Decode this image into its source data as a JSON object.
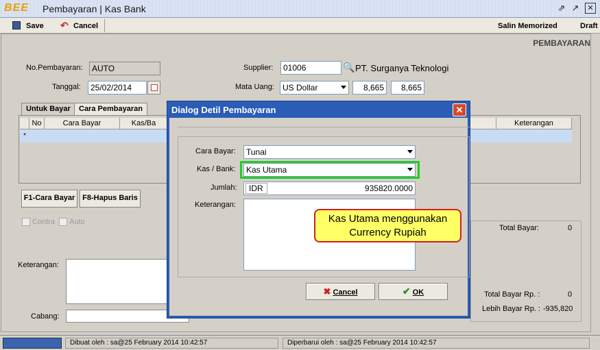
{
  "window": {
    "logo": "BEE",
    "title": "Pembayaran | Kas Bank"
  },
  "toolbar": {
    "save": "Save",
    "cancel": "Cancel",
    "salin": "Salin Memorized",
    "draft": "Draft"
  },
  "section_title": "PEMBAYARAN",
  "form": {
    "no_label": "No.Pembayaran:",
    "no_value": "AUTO",
    "tanggal_label": "Tanggal:",
    "tanggal_value": "25/02/2014",
    "supplier_label": "Supplier:",
    "supplier_code": "01006",
    "supplier_name": "PT. Surganya Teknologi",
    "mata_uang_label": "Mata Uang:",
    "mata_uang_value": "US Dollar",
    "rate1": "8,665",
    "rate2": "8,665"
  },
  "tabs": [
    "Untuk Bayar",
    "Cara Pembayaran"
  ],
  "grid": {
    "columns": [
      "No",
      "Cara Bayar",
      "Kas/Ba",
      "Keterangan"
    ],
    "new_row_marker": "*"
  },
  "buttons": {
    "f1": "F1-Cara Bayar",
    "f8": "F8-Hapus Baris"
  },
  "options": {
    "contra": "Contra",
    "auto": "Auto"
  },
  "footer_form": {
    "keterangan_label": "Keterangan:",
    "cabang_label": "Cabang:"
  },
  "totals": {
    "total_bayar_label": "Total Bayar:",
    "total_bayar_value": "0",
    "total_bayar_rp_label": "Total Bayar Rp. :",
    "total_bayar_rp_value": "0",
    "lebih_bayar_label": "Lebih Bayar Rp. :",
    "lebih_bayar_value": "-935,820"
  },
  "status": {
    "dibuat": "Dibuat oleh : sa@25 February 2014  10:42:57",
    "diperbarui": "Diperbarui oleh : sa@25 February 2014  10:42:57"
  },
  "dialog": {
    "title": "Dialog Detil Pembayaran",
    "cara_bayar_label": "Cara Bayar:",
    "cara_bayar_value": "Tunai",
    "kas_bank_label": "Kas / Bank:",
    "kas_bank_value": "Kas Utama",
    "jumlah_label": "Jumlah:",
    "jumlah_currency": "IDR",
    "jumlah_value": "935820.0000",
    "keterangan_label": "Keterangan:",
    "cancel": "Cancel",
    "ok": "OK"
  },
  "callout": {
    "line1": "Kas Utama menggunakan",
    "line2": "Currency Rupiah"
  },
  "colors": {
    "dialog_frame": "#2b5db8",
    "highlight": "#22cc22",
    "callout_bg": "#ffff66",
    "callout_border": "#d02020"
  }
}
